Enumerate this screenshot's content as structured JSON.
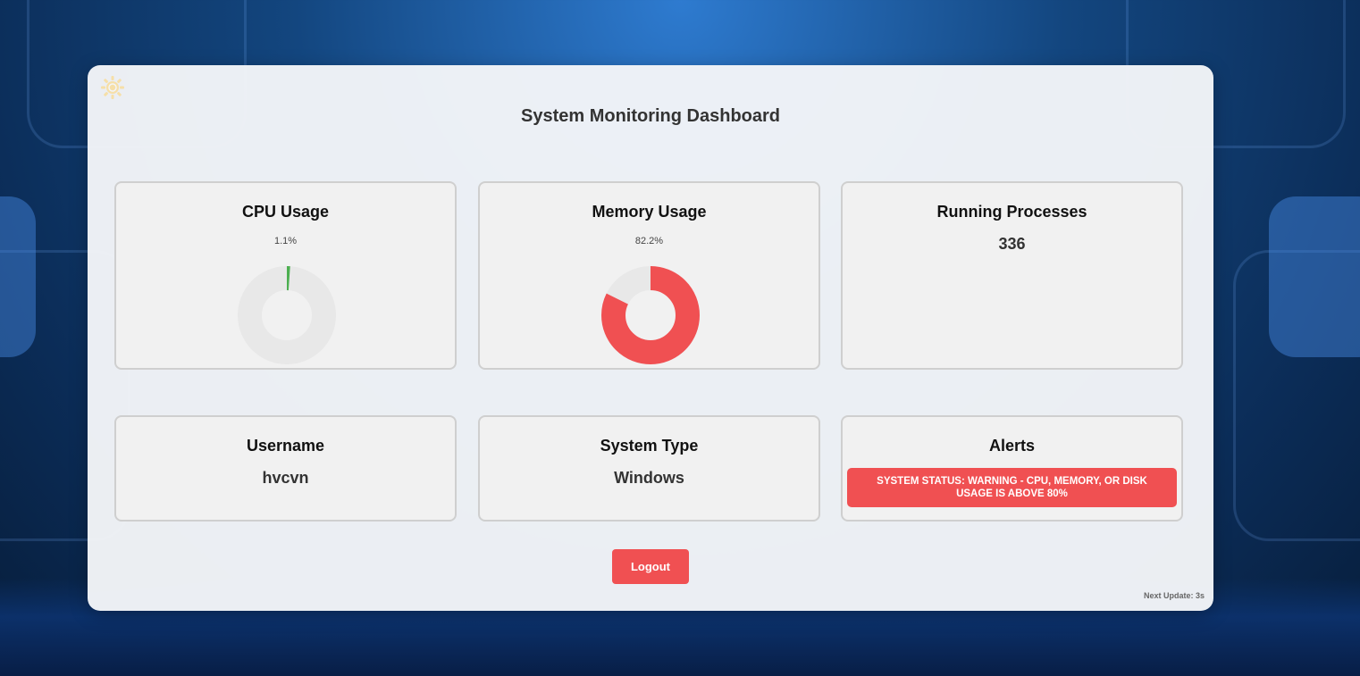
{
  "dashboard": {
    "title": "System Monitoring Dashboard",
    "theme_toggle_icon": "sun-icon",
    "accent_color": "#f05052",
    "ok_color": "#4caf50"
  },
  "cards": {
    "cpu": {
      "title": "CPU Usage",
      "percent_text": "1.1%",
      "percent": 1.1
    },
    "memory": {
      "title": "Memory Usage",
      "percent_text": "82.2%",
      "percent": 82.2
    },
    "processes": {
      "title": "Running Processes",
      "value": "336"
    },
    "username": {
      "title": "Username",
      "value": "hvcvn"
    },
    "system_type": {
      "title": "System Type",
      "value": "Windows"
    },
    "alerts": {
      "title": "Alerts",
      "message": "SYSTEM STATUS: WARNING - CPU, MEMORY, OR DISK USAGE IS ABOVE 80%"
    }
  },
  "actions": {
    "logout_label": "Logout"
  },
  "footer": {
    "next_update": "Next Update: 3s"
  }
}
